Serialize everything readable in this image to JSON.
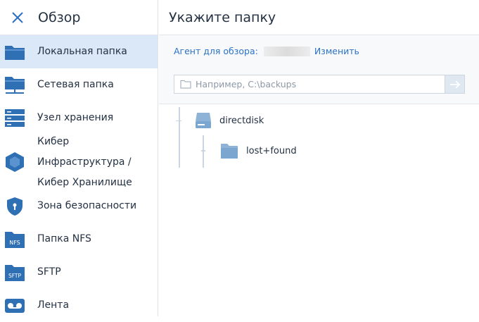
{
  "sidebar": {
    "title": "Обзор",
    "close_icon": "close-icon",
    "items": [
      {
        "label": "Локальная папка",
        "icon": "folder-icon",
        "active": true
      },
      {
        "label": "Сетевая папка",
        "icon": "network-folder-icon"
      },
      {
        "label": "Узел хранения",
        "icon": "storage-node-icon"
      },
      {
        "label": "Кибер Инфраструктура /",
        "label2": "Кибер Хранилище",
        "icon": "cyber-infrastructure-icon"
      },
      {
        "label": "Зона безопасности",
        "icon": "shield-icon"
      },
      {
        "label": "Папка NFS",
        "icon": "nfs-folder-icon"
      },
      {
        "label": "SFTP",
        "icon": "sftp-icon"
      },
      {
        "label": "Лента",
        "icon": "tape-icon"
      }
    ]
  },
  "main": {
    "title": "Укажите папку",
    "agent_label": "Агент для обзора:",
    "change_link": "Изменить",
    "path_placeholder": "Например, C:\\backups",
    "tree": [
      {
        "label": "directdisk",
        "icon": "disk-icon"
      },
      {
        "label": "lost+found",
        "icon": "folder-icon"
      }
    ]
  },
  "colors": {
    "accent": "#2c72c7",
    "icon_blue": "#2f6fb4",
    "active_bg": "#dbe8f8",
    "tree_icon": "#7aa6cf"
  }
}
